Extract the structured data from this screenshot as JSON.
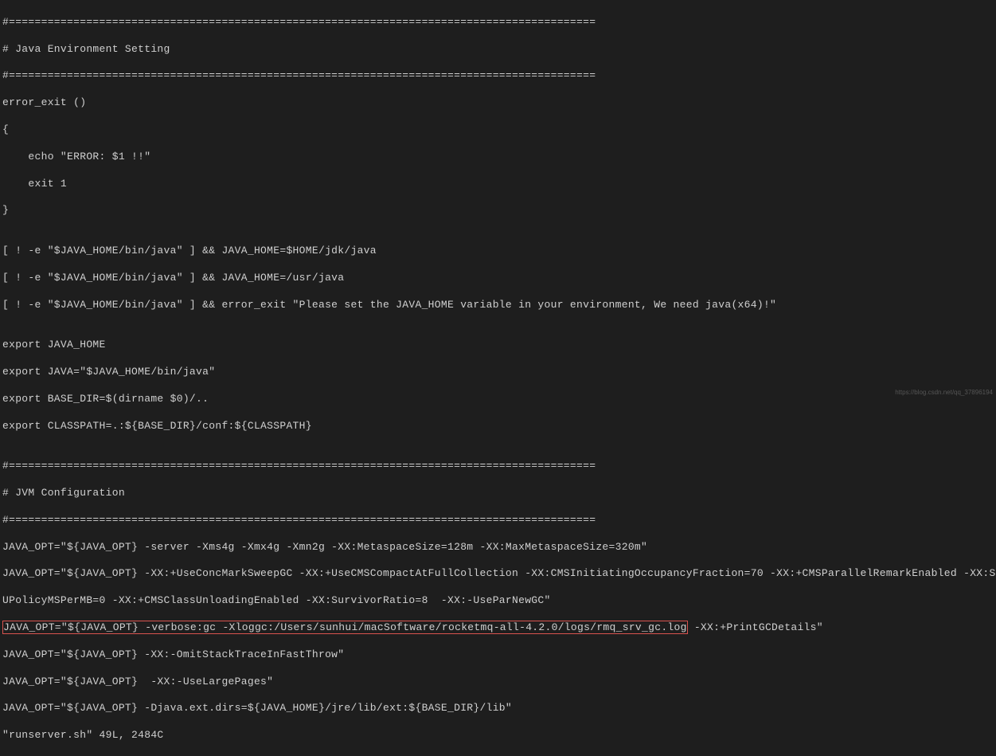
{
  "lines": {
    "l1": "#===========================================================================================",
    "l2": "# Java Environment Setting",
    "l3": "#===========================================================================================",
    "l4": "error_exit ()",
    "l5": "{",
    "l6": "    echo \"ERROR: $1 !!\"",
    "l7": "    exit 1",
    "l8": "}",
    "l9": "",
    "l10": "[ ! -e \"$JAVA_HOME/bin/java\" ] && JAVA_HOME=$HOME/jdk/java",
    "l11": "[ ! -e \"$JAVA_HOME/bin/java\" ] && JAVA_HOME=/usr/java",
    "l12": "[ ! -e \"$JAVA_HOME/bin/java\" ] && error_exit \"Please set the JAVA_HOME variable in your environment, We need java(x64)!\"",
    "l13": "",
    "l14": "export JAVA_HOME",
    "l15": "export JAVA=\"$JAVA_HOME/bin/java\"",
    "l16": "export BASE_DIR=$(dirname $0)/..",
    "l17": "export CLASSPATH=.:${BASE_DIR}/conf:${CLASSPATH}",
    "l18": "",
    "l19": "#===========================================================================================",
    "l20": "# JVM Configuration",
    "l21": "#===========================================================================================",
    "l22": "JAVA_OPT=\"${JAVA_OPT} -server -Xms4g -Xmx4g -Xmn2g -XX:MetaspaceSize=128m -XX:MaxMetaspaceSize=320m\"",
    "l23": "JAVA_OPT=\"${JAVA_OPT} -XX:+UseConcMarkSweepGC -XX:+UseCMSCompactAtFullCollection -XX:CMSInitiatingOccupancyFraction=70 -XX:+CMSParallelRemarkEnabled -XX:S",
    "l24": "UPolicyMSPerMB=0 -XX:+CMSClassUnloadingEnabled -XX:SurvivorRatio=8  -XX:-UseParNewGC\"",
    "l25_prefix": "JAVA_OPT=\"${JAVA_OPT} -verbose:gc -Xloggc:/Users/sunhui/macSoftware/rocketmq-all-4.2.0/logs/rmq_srv_gc.log",
    "l25_suffix": " -XX:+PrintGCDetails\"",
    "l26": "JAVA_OPT=\"${JAVA_OPT} -XX:-OmitStackTraceInFastThrow\"",
    "l27": "JAVA_OPT=\"${JAVA_OPT}  -XX:-UseLargePages\"",
    "l28": "JAVA_OPT=\"${JAVA_OPT} -Djava.ext.dirs=${JAVA_HOME}/jre/lib/ext:${BASE_DIR}/lib\"",
    "l29": "\"runserver.sh\" 49L, 2484C"
  },
  "watermark": "https://blog.csdn.net/qq_37896194"
}
